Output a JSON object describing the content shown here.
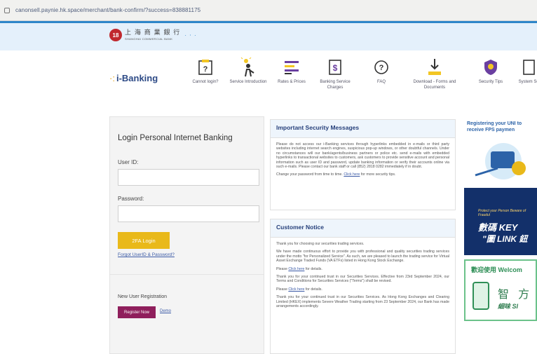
{
  "browser": {
    "url": "canonsell.paynie.hk.space/merchant/bank-confirm/?success=838881175"
  },
  "header": {
    "seal_text": "18",
    "bank_name_zh": "上 海 商 業 銀 行",
    "bank_name_en": "SHANGHAI COMMERCIAL BANK"
  },
  "brand": {
    "star": "·:",
    "name": "i-Banking"
  },
  "nav": [
    {
      "label": "Cannot login?",
      "icon": "question-doc-icon"
    },
    {
      "label": "Service Introduction",
      "icon": "lightbulb-person-icon"
    },
    {
      "label": "Rates & Prices",
      "icon": "rates-bars-icon"
    },
    {
      "label": "Banking Service Charges",
      "icon": "dollar-doc-icon"
    },
    {
      "label": "FAQ",
      "icon": "faq-question-icon"
    },
    {
      "label": "Download - Forms and Documents",
      "icon": "download-icon"
    },
    {
      "label": "Security Tips",
      "icon": "shield-icon"
    },
    {
      "label": "System Sc",
      "icon": "system-doc-icon"
    }
  ],
  "login": {
    "title": "Login Personal Internet Banking",
    "user_id_label": "User ID:",
    "password_label": "Password:",
    "login_button": "2FA Login",
    "forgot_link": "Forgot UserID & Password?",
    "new_user_label": "New User Registration",
    "register_button": "Register Now",
    "demo_link": "Demo"
  },
  "security": {
    "title": "Important Security Messages",
    "para1": "Please do not access our i-Banking services through hyperlinks embedded in e-mails or third party websites including internet search engines, suspicious pop-up windows, or other doubtful channels. Under no circumstances will our bank/agents/business partners or police etc. send e-mails with embedded hyperlinks to transactional websites to customers, ask customers to provide sensitive account and personal information such as user ID and password, update banking information or verify their accounts online via such e-mails. Please contact our bank staff or call (852) 2818 0282 immediately if in doubt.",
    "para2_text": "Change your password from time to time.",
    "para2_link": "Click here",
    "para2_tail": "for more security tips."
  },
  "customer": {
    "title": "Customer Notice",
    "p1": "Thank you for choosing our securities trading services.",
    "p2": "We have made continuous effort to provide you with professional and quality securities trading services under the motto \"for Personalized Service\". As such, we are pleased to launch the trading service for Virtual Asset Exchange Traded Funds (VA ETFs) listed in Hong Kong Stock Exchange.",
    "p3_pre": "Please",
    "p3_link": "Click here",
    "p3_post": "for details.",
    "p4": "Thank you for your continued trust in our Securities Services. Effective from 23rd September 2024, our Terms and Conditions for Securities Services (\"Terms\") shall be revised.",
    "p5_pre": "Please",
    "p5_link": "Click here",
    "p5_post": "for details.",
    "p6": "Thank you for your continued trust in our Securities Services. As Hong Kong Exchanges and Clearing Limited (HKEX) implements Severe Weather Trading starting from 23 September 2024, our Bank has made arrangements accordingly."
  },
  "promos": {
    "fps_title": "Registering your UNI to receive FPS paymen",
    "key_tag": "Protect your Person Beware of Fraudul",
    "key_line1": "數碼 KEY",
    "key_line2": "\"圖 LINK 鈕",
    "welcome": "歡迎使用 Welcom",
    "zh_big": "智 方",
    "zh_sub": "細味 SI"
  },
  "colors": {
    "accent": "#2e86c9",
    "login_button": "#e9b91a",
    "register_button": "#8f1f5c",
    "brand_text": "#2d4a86"
  }
}
